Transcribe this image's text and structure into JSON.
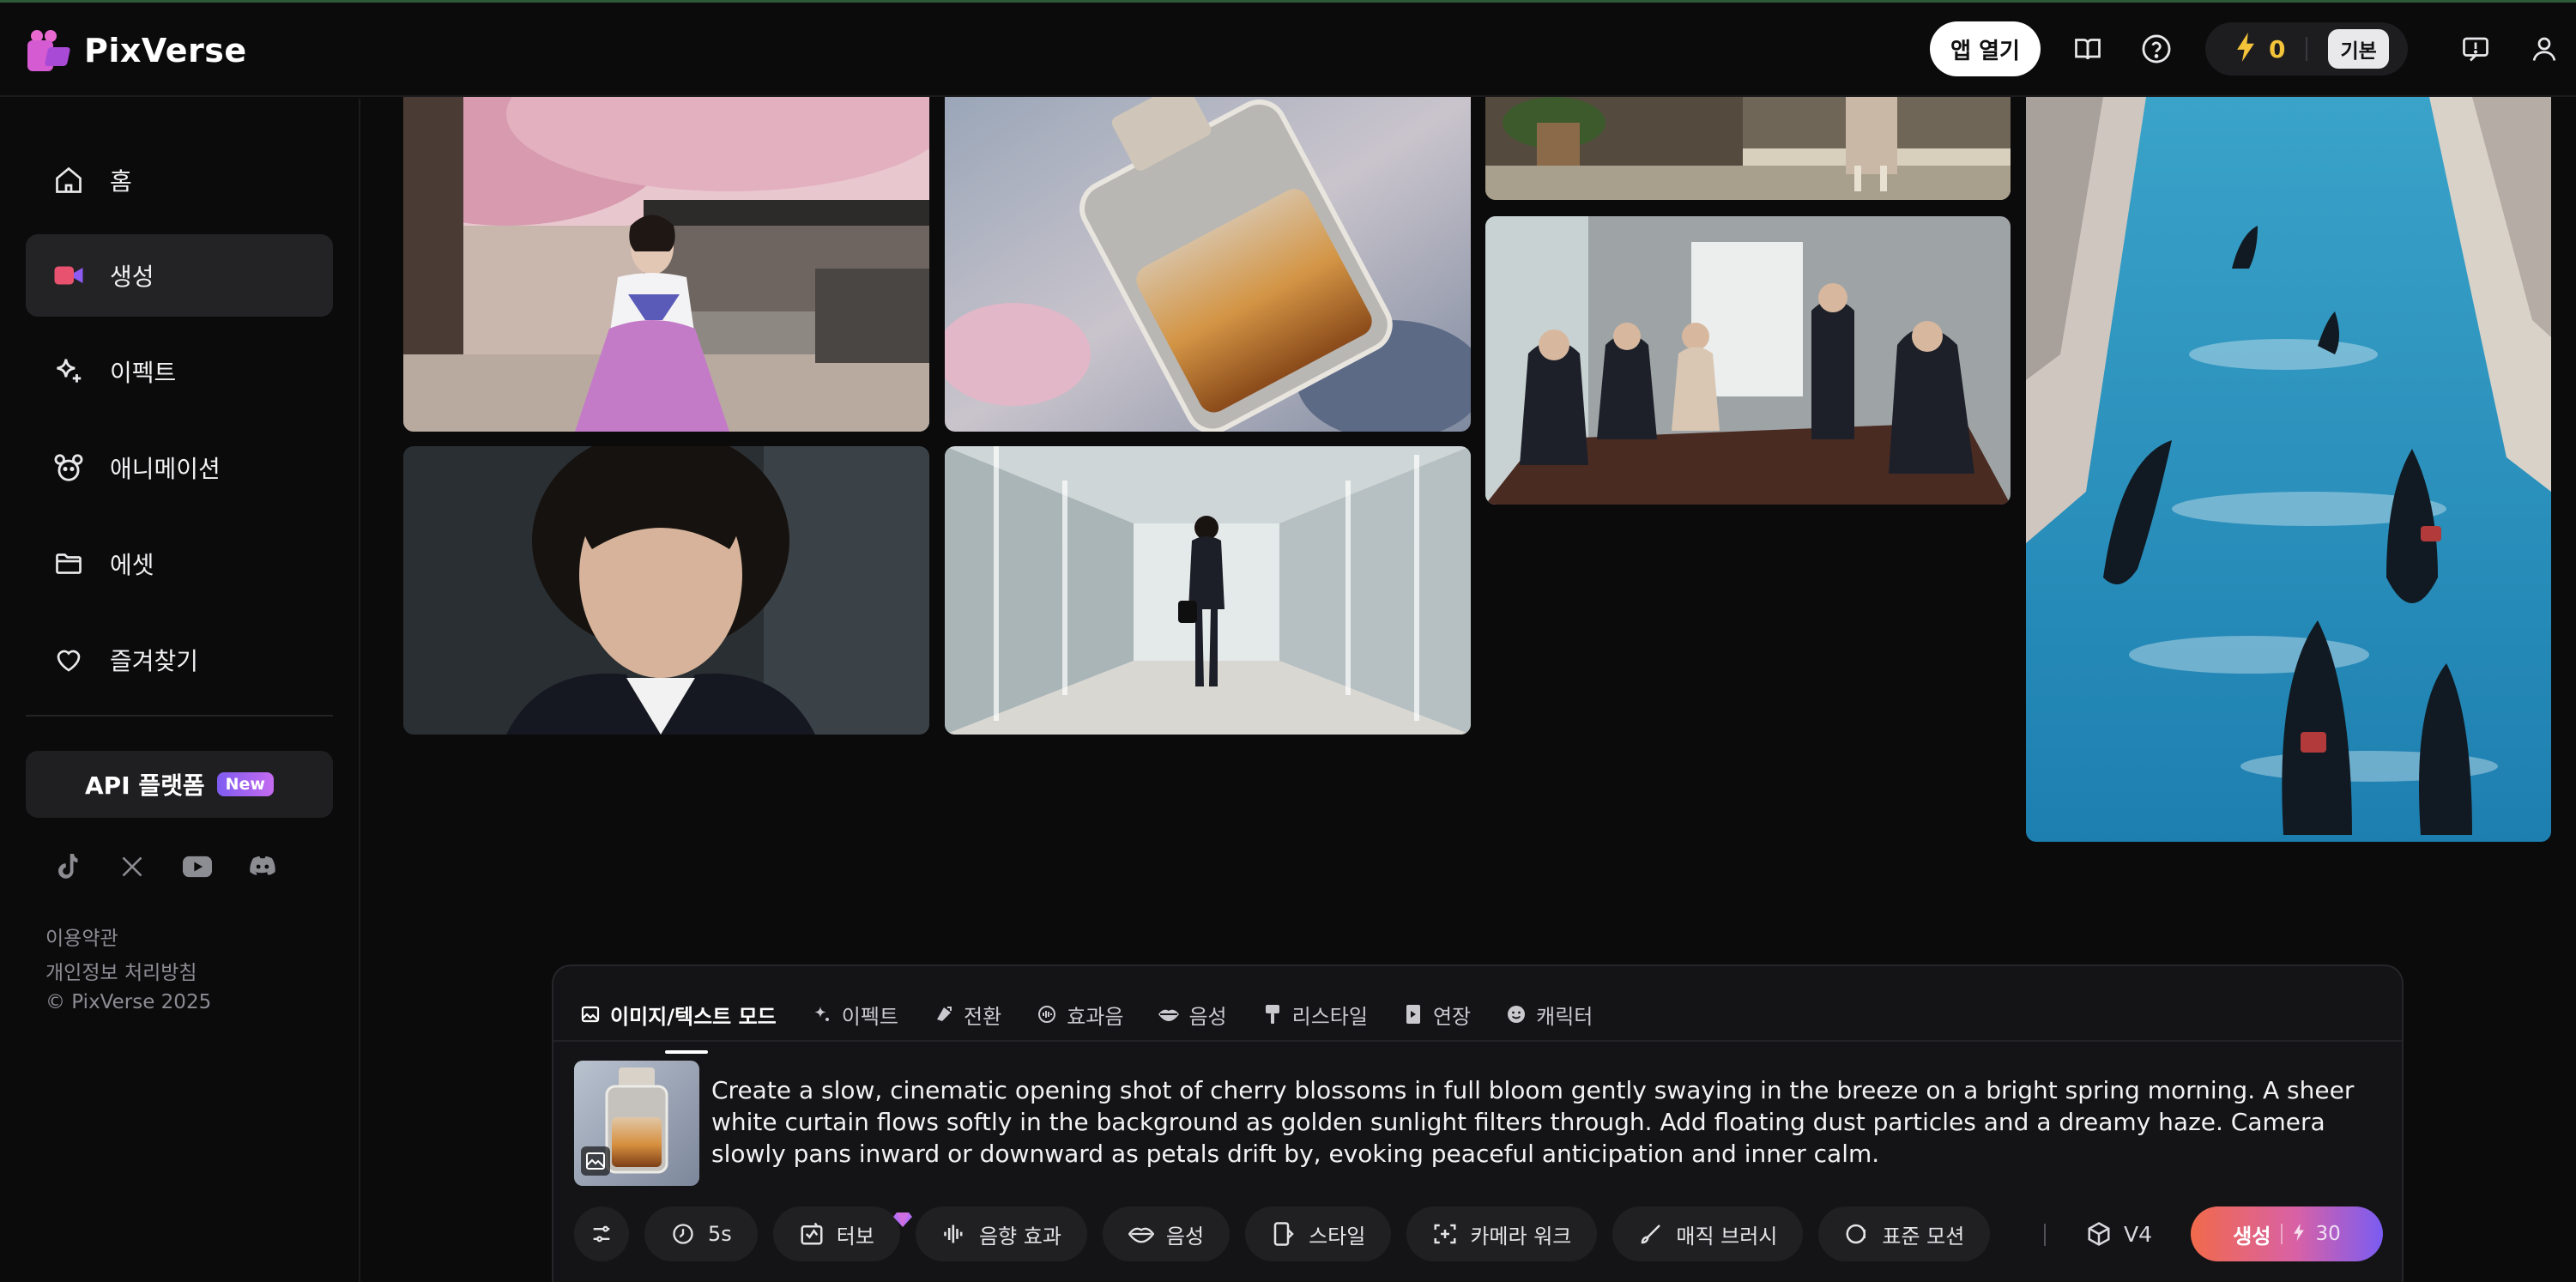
{
  "app": {
    "name": "PixVerse"
  },
  "header": {
    "open_app_label": "앱 열기",
    "credits": "0",
    "plan": "기본",
    "icons": [
      "book-icon",
      "help-icon",
      "lightning-icon",
      "feedback-icon",
      "user-icon"
    ]
  },
  "sidebar": {
    "items": [
      {
        "label": "홈",
        "icon": "home-icon"
      },
      {
        "label": "생성",
        "icon": "video-camera-icon",
        "active": true
      },
      {
        "label": "이펙트",
        "icon": "sparkle-icon"
      },
      {
        "label": "애니메이션",
        "icon": "character-icon"
      },
      {
        "label": "에셋",
        "icon": "folder-icon"
      },
      {
        "label": "즐겨찾기",
        "icon": "heart-icon"
      }
    ],
    "api_label": "API 플랫폼",
    "api_badge": "New",
    "socials": [
      "tiktok-icon",
      "x-icon",
      "youtube-icon",
      "discord-icon"
    ],
    "footer": {
      "terms": "이용약관",
      "privacy": "개인정보 처리방침",
      "copyright": "© PixVerse 2025"
    }
  },
  "gallery": [
    {
      "subject": "hanbok-woman-cherry-blossom"
    },
    {
      "subject": "perfume-bottle"
    },
    {
      "subject": "street-walk"
    },
    {
      "subject": "venice-canal-gondolas"
    },
    {
      "subject": "business-meeting"
    },
    {
      "subject": "businesswoman-portrait"
    },
    {
      "subject": "businesswoman-corridor"
    }
  ],
  "composer": {
    "tabs": [
      {
        "label": "이미지/텍스트 모드",
        "icon": "image-icon",
        "active": true
      },
      {
        "label": "이펙트",
        "icon": "sparkle-icon"
      },
      {
        "label": "전환",
        "icon": "transition-icon"
      },
      {
        "label": "효과음",
        "icon": "sound-icon"
      },
      {
        "label": "음성",
        "icon": "lips-icon"
      },
      {
        "label": "리스타일",
        "icon": "brush-icon"
      },
      {
        "label": "연장",
        "icon": "extend-icon"
      },
      {
        "label": "캐릭터",
        "icon": "smile-icon"
      }
    ],
    "prompt": "Create a slow, cinematic opening shot of cherry blossoms in full bloom gently swaying in the breeze on a bright spring morning. A sheer white curtain flows softly in the background as golden sunlight filters through. Add floating dust particles and a dreamy haze. Camera slowly pans inward or downward as petals drift by, evoking peaceful anticipation and inner calm.",
    "tools": [
      {
        "label": "5s",
        "icon": "clock-icon"
      },
      {
        "label": "터보",
        "icon": "turbo-icon"
      },
      {
        "label": "음향 효과",
        "icon": "waveform-icon"
      },
      {
        "label": "음성",
        "icon": "lips-icon"
      },
      {
        "label": "스타일",
        "icon": "style-icon"
      },
      {
        "label": "카메라 워크",
        "icon": "camera-move-icon"
      },
      {
        "label": "매직 브러시",
        "icon": "magic-brush-icon"
      },
      {
        "label": "표준 모션",
        "icon": "motion-icon"
      }
    ],
    "model": "V4",
    "generate_label": "생성",
    "generate_cost": "30"
  },
  "colors": {
    "background": "#0b0b0c",
    "panel": "#141416",
    "credit": "#f3c33a",
    "generate_gradient": [
      "#f16a4b",
      "#d861a6",
      "#7a5cf2"
    ]
  }
}
